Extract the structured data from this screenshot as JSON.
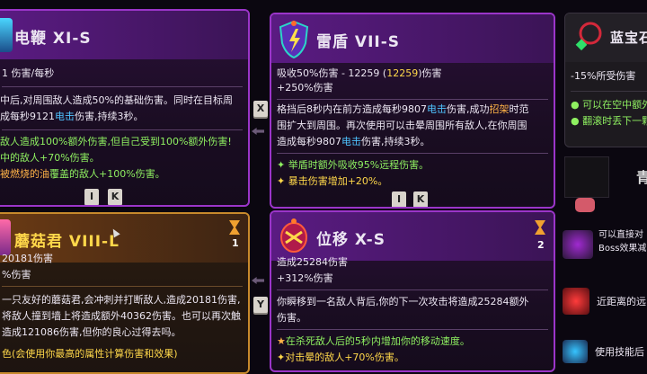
{
  "cards": {
    "whip": {
      "title": "电鞭  XI-S",
      "stat": "1 伤害/每秒",
      "desc1": "中后,对周围敌人造成50%的基础伤害。同时在目标周",
      "desc2_a": "成每秒9121",
      "desc2_b": "电击",
      "desc2_c": "伤害,持续3秒。",
      "mod1": "敌人造成100%额外伤害,但自己受到100%额外伤害!",
      "mod2": "中的敌人+70%伤害。",
      "mod3_a": "被燃烧的油",
      "mod3_b": "覆盖的敌人+100%伤害。",
      "key1": "I",
      "key2": "K"
    },
    "shield": {
      "title": "雷盾  VII-S",
      "stat1_a": "吸收50%伤害 - 12259 (",
      "stat1_b": "12259",
      "stat1_c": ")伤害",
      "stat2": "+250%伤害",
      "desc1_a": "格挡后8秒内在前方造成每秒9807",
      "desc1_b": "电击",
      "desc1_c": "伤害,成功",
      "desc1_d": "招架",
      "desc1_e": "时范",
      "desc2": "围扩大到周围。再次使用可以击晕周围所有敌人,在你周围",
      "desc3_a": "造成每秒9807",
      "desc3_b": "电击",
      "desc3_c": "伤害,持续3秒。",
      "mod1": "举盾时额外吸收95%远程伤害。",
      "mod2": "暴击伤害增加+20%。",
      "key1": "I",
      "key2": "K"
    },
    "gem": {
      "title": "蓝宝石",
      "stat": "-15%所受伤害",
      "mod1": "可以在空中额外",
      "mod2": "翻滚时丢下一颗"
    },
    "mushroom": {
      "title": "蘑菇君  VIII-L",
      "count": "1",
      "stat1": "20181伤害",
      "stat2": "%伤害",
      "desc1": "一只友好的蘑菇君,会冲刺并打断敌人,造成20181伤害,",
      "desc2": "将敌人撞到墙上将造成额外40362伤害。也可以再次触",
      "desc3": "造成121086伤害,但你的良心过得去吗。",
      "mod1": "色(会使用你最高的属性计算伤害和效果)"
    },
    "blink": {
      "title": "位移  X-S",
      "count": "2",
      "stat1": "造成25284伤害",
      "stat2": "+312%伤害",
      "desc1": "你瞬移到一名敌人背后,你的下一次攻击将造成25284额外",
      "desc2": "伤害。",
      "mod1": "在杀死敌人后的5秒内增加你的移动速度。",
      "mod2": "对击晕的敌人+70%伤害。"
    },
    "side": {
      "letter": "青",
      "item1": "可以直接对",
      "item1b": "Boss效果减",
      "item2": "近距离的远",
      "item3": "使用技能后"
    }
  },
  "keys": {
    "x": "X",
    "y": "Y"
  },
  "colors": {
    "purple": "#9b35c9",
    "gold": "#c88a2c",
    "electric": "#4fc3ff",
    "green": "#8ff061"
  }
}
